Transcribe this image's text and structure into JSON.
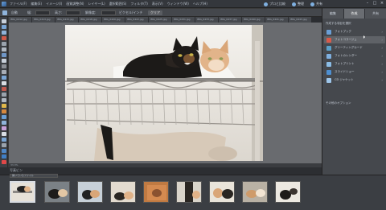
{
  "menubar": {
    "items": [
      "ファイル(F)",
      "編集(E)",
      "イメージ(I)",
      "画質調整(N)",
      "レイヤー(L)",
      "選択範囲(S)",
      "フィルタ(T)",
      "表示(V)",
      "ウィンドウ(W)",
      "ヘルプ(H)"
    ],
    "right": [
      {
        "label": "プロと比較",
        "icon": "compare-icon"
      },
      {
        "label": "整理",
        "icon": "organize-icon"
      },
      {
        "label": "共有",
        "icon": "share-icon"
      }
    ],
    "window": {
      "minimize": "–",
      "maximize": "□",
      "close": "×"
    }
  },
  "optionsbar": {
    "labels": [
      "自動",
      "幅:",
      "高さ:",
      "解像度:",
      "ピクセル/インチ"
    ],
    "button": "クリア"
  },
  "doc_tabs": [
    "IMG_0412.jpg",
    "IMG_0413.jpg",
    "IMG_0415.jpg",
    "IMG_0418.jpg",
    "IMG_0420.jpg",
    "IMG_0422.jpg",
    "IMG_0425.jpg",
    "IMG_0431.jpg",
    "IMG_0433.jpg",
    "IMG_0437.jpg",
    "IMG_0440.jpg",
    "IMG_0441.jpg",
    "IMG_0443.jpg"
  ],
  "status": "33.3%",
  "bin": {
    "title": "写真ビン",
    "control": "開いているファイル"
  },
  "panel": {
    "tabs": [
      {
        "label": "編集",
        "active": false
      },
      {
        "label": "作成",
        "active": true
      },
      {
        "label": "共有",
        "active": false
      }
    ],
    "heading": "作成する項目を選択",
    "rows": [
      {
        "label": "フォトブック",
        "color": "#6a9fd6"
      },
      {
        "label": "フォトコラージュ",
        "color": "#d85a4a",
        "highlight": true
      },
      {
        "label": "グリーティングカード",
        "color": "#5aa0c8"
      },
      {
        "label": "フォトカレンダー",
        "color": "#7fb0e0"
      },
      {
        "label": "フォトプリント",
        "color": "#8bbde6"
      },
      {
        "label": "スライドショー",
        "color": "#4d8fd1"
      },
      {
        "label": "CD ジャケット",
        "color": "#9ec6ea"
      }
    ],
    "more": "その他のオプション"
  }
}
